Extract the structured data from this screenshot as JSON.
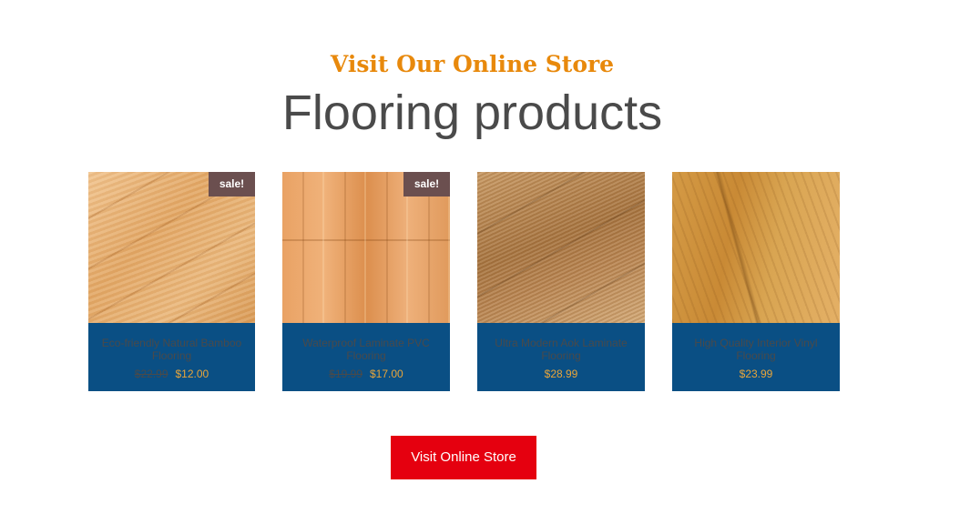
{
  "section": {
    "eyebrow": "Visit Our Online Store",
    "heading": "Flooring products"
  },
  "products": [
    {
      "badge": "sale!",
      "title": "Eco-friendly Natural Bamboo Flooring",
      "old_price": "$22.99",
      "price": "$12.00"
    },
    {
      "badge": "sale!",
      "title": "Waterproof Laminate PVC Flooring",
      "old_price": "$19.99",
      "price": "$17.00"
    },
    {
      "title": "Ultra Modern Aok Laminate Flooring",
      "price": "$28.99"
    },
    {
      "title": "High Quality Interior Vinyl Flooring",
      "price": "$23.99"
    }
  ],
  "cta": {
    "label": "Visit Online Store"
  },
  "colors": {
    "eyebrow": "#e8890c",
    "heading": "#4a4a4a",
    "card_footer": "#0a4f84",
    "price": "#e8a53a",
    "sale_badge": "#6b4f4f",
    "cta_background": "#e5000f"
  }
}
